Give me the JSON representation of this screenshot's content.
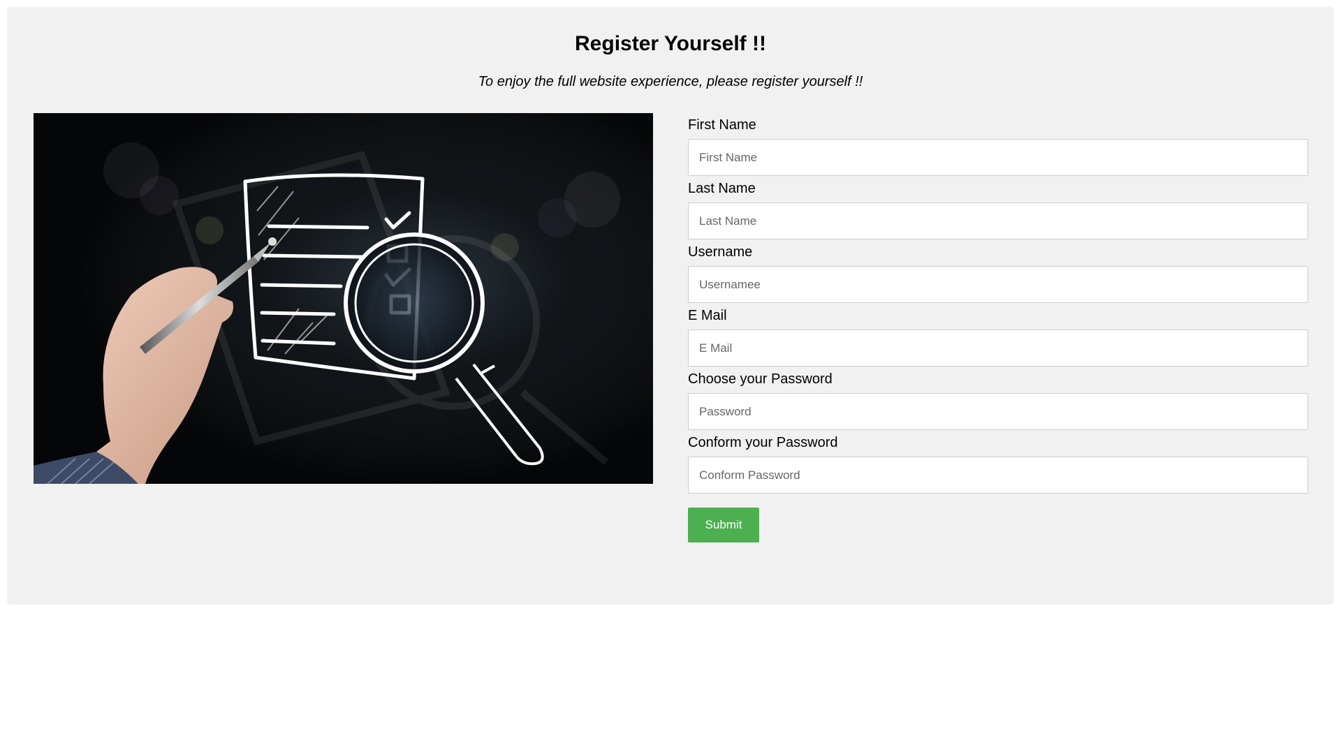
{
  "header": {
    "title": "Register Yourself !!",
    "subtitle": "To enjoy the full website experience, please register yourself !!"
  },
  "illustration": {
    "icon": "registration-illustration-icon"
  },
  "form": {
    "fields": [
      {
        "label": "First Name",
        "placeholder": "First Name"
      },
      {
        "label": "Last Name",
        "placeholder": "Last Name"
      },
      {
        "label": "Username",
        "placeholder": "Usernamee"
      },
      {
        "label": "E Mail",
        "placeholder": "E Mail"
      },
      {
        "label": "Choose your Password",
        "placeholder": "Password"
      },
      {
        "label": "Conform your Password",
        "placeholder": "Conform Password"
      }
    ],
    "submit_label": "Submit"
  },
  "colors": {
    "card_background": "#f1f1f1",
    "submit_background": "#4caf50",
    "illustration_background": "#060708"
  }
}
